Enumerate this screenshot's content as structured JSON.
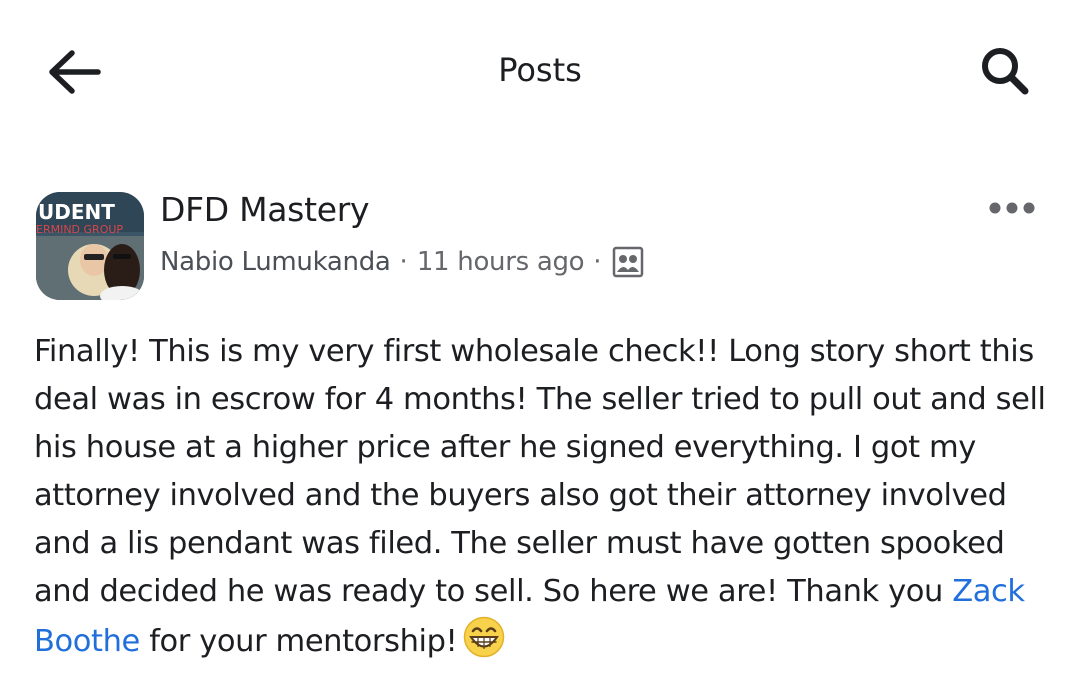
{
  "header": {
    "title": "Posts",
    "back_icon": "arrow-left-icon",
    "search_icon": "search-icon"
  },
  "post": {
    "group_name": "DFD Mastery",
    "author": "Nabio Lumukanda",
    "separator": "·",
    "time": "11 hours ago",
    "privacy_icon": "group-members-icon",
    "more_icon": "more-horizontal-icon",
    "avatar_text_top": "UDENT",
    "avatar_text_sub": "ERMIND GROUP",
    "body_before_mention": "Finally! This is my very first wholesale check!! Long story short this deal was in escrow for 4 months! The seller tried to pull out and sell his house at a higher price after he signed everything. I got my attorney involved and the buyers also got their attorney involved and a lis pendant was filed. The seller must have gotten spooked and decided he was ready to sell. So here we are! Thank you ",
    "mention": "Zack Boothe",
    "body_after_mention": " for your mentorship!",
    "emoji": "grinning-face-emoji"
  },
  "colors": {
    "text": "#1c1e21",
    "secondary": "#65676b",
    "mention": "#216fdb",
    "avatar_bg": "#2f4a5c",
    "avatar_accent": "#c8323a"
  }
}
